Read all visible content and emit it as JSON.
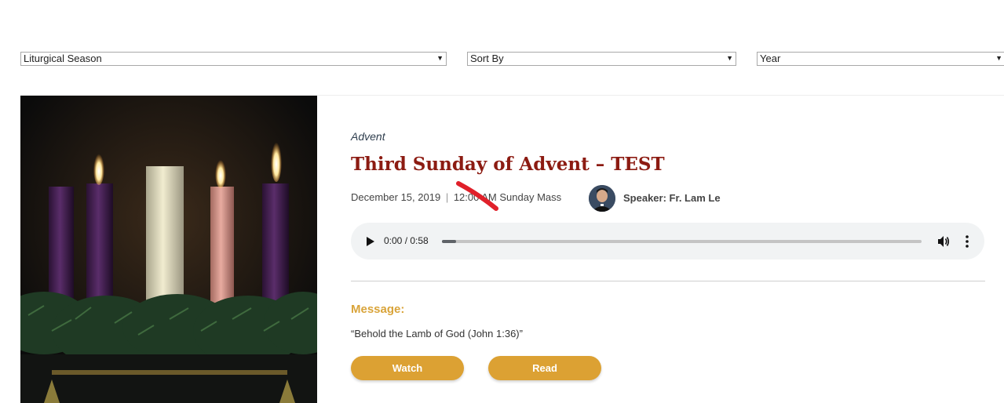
{
  "filters": {
    "season": "Liturgical Season",
    "sort": "Sort By",
    "year": "Year"
  },
  "card": {
    "image_alt": "Advent wreath candles",
    "season": "Advent",
    "title": "Third Sunday of Advent – TEST",
    "date": "December 15, 2019",
    "separator": "|",
    "time_service": "12:00 AM Sunday Mass",
    "speaker": "Speaker: Fr. Lam Le",
    "audio": {
      "time": "0:00 / 0:58",
      "progress": 0.03
    },
    "message_label": "Message:",
    "message_text": "“Behold the Lamb of God (John 1:36)”",
    "watch_label": "Watch",
    "read_label": "Read"
  },
  "colors": {
    "title": "#8c1b12",
    "accent": "#dca133",
    "annotation": "#e0202a"
  },
  "icons": [
    "chevron-down-icon",
    "play-icon",
    "volume-icon",
    "more-vert-icon"
  ]
}
